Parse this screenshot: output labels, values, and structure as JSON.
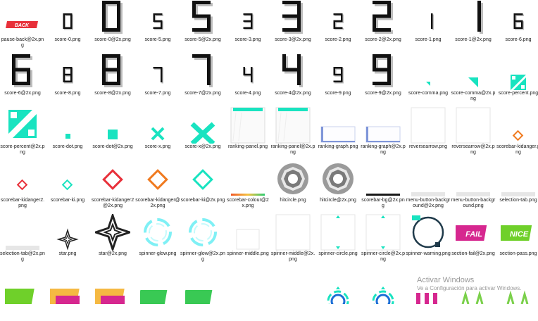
{
  "files": [
    {
      "label": "pause-back@2x.png",
      "icon": "pause-back"
    },
    {
      "label": "score-0.png",
      "icon": "digit-0-small"
    },
    {
      "label": "score-0@2x.png",
      "icon": "digit-0-large"
    },
    {
      "label": "score-5.png",
      "icon": "digit-5-small"
    },
    {
      "label": "score-5@2x.png",
      "icon": "digit-5-large"
    },
    {
      "label": "score-3.png",
      "icon": "digit-3-small"
    },
    {
      "label": "score-3@2x.png",
      "icon": "digit-3-large"
    },
    {
      "label": "score-2.png",
      "icon": "digit-2-small"
    },
    {
      "label": "score-2@2x.png",
      "icon": "digit-2-large"
    },
    {
      "label": "score-1.png",
      "icon": "digit-1-small"
    },
    {
      "label": "score-1@2x.png",
      "icon": "digit-1-large"
    },
    {
      "label": "score-6.png",
      "icon": "digit-6-small"
    },
    {
      "label": "score-6@2x.png",
      "icon": "digit-6-large"
    },
    {
      "label": "score-8.png",
      "icon": "digit-8-small"
    },
    {
      "label": "score-8@2x.png",
      "icon": "digit-8-large"
    },
    {
      "label": "score-7.png",
      "icon": "digit-7-small"
    },
    {
      "label": "score-7@2x.png",
      "icon": "digit-7-large"
    },
    {
      "label": "score-4.png",
      "icon": "digit-4-small"
    },
    {
      "label": "score-4@2x.png",
      "icon": "digit-4-large"
    },
    {
      "label": "score-9.png",
      "icon": "digit-9-small"
    },
    {
      "label": "score-9@2x.png",
      "icon": "digit-9-large"
    },
    {
      "label": "score-comma.png",
      "icon": "comma-small"
    },
    {
      "label": "score-comma@2x.png",
      "icon": "comma-large"
    },
    {
      "label": "score-percent.png",
      "icon": "percent-small"
    },
    {
      "label": "score-percent@2x.png",
      "icon": "percent-large"
    },
    {
      "label": "score-dot.png",
      "icon": "dot-small"
    },
    {
      "label": "score-dot@2x.png",
      "icon": "dot-large"
    },
    {
      "label": "score-x.png",
      "icon": "x-small"
    },
    {
      "label": "score-x@2x.png",
      "icon": "x-large"
    },
    {
      "label": "ranking-panel.png",
      "icon": "ranking-panel"
    },
    {
      "label": "ranking-panel@2x.png",
      "icon": "ranking-panel"
    },
    {
      "label": "ranking-graph.png",
      "icon": "ranking-graph"
    },
    {
      "label": "ranking-graph@2x.png",
      "icon": "ranking-graph"
    },
    {
      "label": "reversearrow.png",
      "icon": "blank"
    },
    {
      "label": "reversearrow@2x.png",
      "icon": "blank"
    },
    {
      "label": "scorebar-kidanger.png",
      "icon": "diamond-orange-small"
    },
    {
      "label": "scorebar-kidanger2.png",
      "icon": "diamond-red-small"
    },
    {
      "label": "scorebar-ki.png",
      "icon": "diamond-teal-small"
    },
    {
      "label": "scorebar-kidanger2@2x.png",
      "icon": "diamond-red-large"
    },
    {
      "label": "scorebar-kidanger@2x.png",
      "icon": "diamond-orange-large"
    },
    {
      "label": "scorebar-ki@2x.png",
      "icon": "diamond-teal-large"
    },
    {
      "label": "scorebar-colour@2x.png",
      "icon": "scorebar-colour"
    },
    {
      "label": "hitcircle.png",
      "icon": "hitcircle"
    },
    {
      "label": "hitcircle@2x.png",
      "icon": "hitcircle"
    },
    {
      "label": "scorebar-bg@2x.png",
      "icon": "scorebar-bg"
    },
    {
      "label": "menu-button-background@2x.png",
      "icon": "bar-grey"
    },
    {
      "label": "menu-button-background.png",
      "icon": "bar-grey"
    },
    {
      "label": "selection-tab.png",
      "icon": "bar-grey"
    },
    {
      "label": "selection-tab@2x.png",
      "icon": "bar-grey"
    },
    {
      "label": "star.png",
      "icon": "star-small"
    },
    {
      "label": "star@2x.png",
      "icon": "star-large"
    },
    {
      "label": "spinner-glow.png",
      "icon": "spinner-glow"
    },
    {
      "label": "spinner-glow@2x.png",
      "icon": "spinner-glow"
    },
    {
      "label": "spinner-middle.png",
      "icon": "blank-small"
    },
    {
      "label": "spinner-middle@2x.png",
      "icon": "blank"
    },
    {
      "label": "spinner-circle.png",
      "icon": "spinner-circle"
    },
    {
      "label": "spinner-circle@2x.png",
      "icon": "spinner-circle"
    },
    {
      "label": "spinner-warning.png",
      "icon": "spinner-warning"
    },
    {
      "label": "section-fail@2x.png",
      "icon": "section-fail"
    },
    {
      "label": "section-pass.png",
      "icon": "section-pass"
    },
    {
      "label": "",
      "icon": "nice-partial"
    },
    {
      "label": "",
      "icon": "fail-partial"
    },
    {
      "label": "",
      "icon": "fail-partial"
    },
    {
      "label": "",
      "icon": "go-partial"
    },
    {
      "label": "",
      "icon": "go-partial"
    },
    {
      "label": "",
      "icon": "none"
    },
    {
      "label": "",
      "icon": "none"
    },
    {
      "label": "",
      "icon": "ring-partial"
    },
    {
      "label": "",
      "icon": "ring-partial"
    },
    {
      "label": "",
      "icon": "warning-partial"
    },
    {
      "label": "",
      "icon": "arrows-partial"
    },
    {
      "label": "",
      "icon": "arrows-partial"
    }
  ],
  "watermark": {
    "title": "Activar Windows",
    "subtitle": "Ve a Configuración para activar Windows."
  },
  "colors": {
    "teal": "#19e3c0",
    "red": "#e8303a",
    "orange": "#f07a1f",
    "blue": "#1d6fd6",
    "cyan": "#2fd8e8",
    "navy": "#1f3a4a",
    "magenta": "#d6278f",
    "green": "#6fd02a"
  }
}
